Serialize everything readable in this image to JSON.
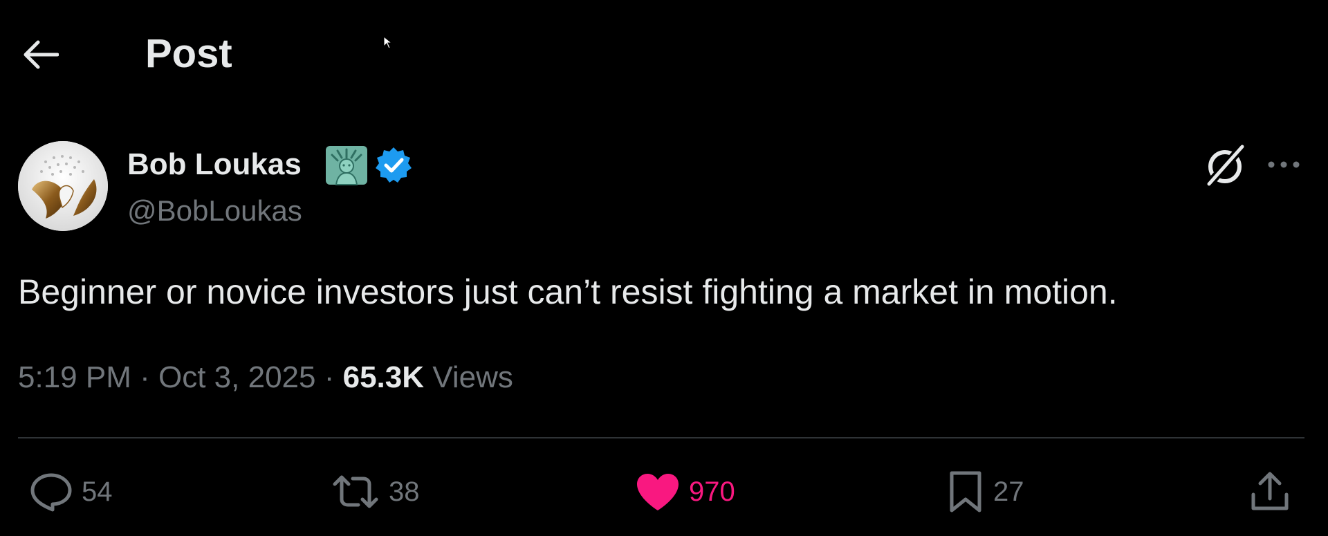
{
  "header": {
    "title": "Post",
    "back_icon": "arrow-left-icon"
  },
  "author": {
    "name": "Bob Loukas",
    "handle": "@BobLoukas",
    "badges": [
      "statue-of-liberty-icon",
      "verified-badge-icon"
    ],
    "verified_color": "#1d9bf0"
  },
  "post": {
    "text": "Beginner or novice investors just can’t resist fighting a market in motion.",
    "time": "5:19 PM",
    "separator": "·",
    "date": "Oct 3, 2025",
    "views_count": "65.3K",
    "views_label": "Views"
  },
  "actions": {
    "replies": "54",
    "reposts": "38",
    "likes": "970",
    "bookmarks": "27",
    "liked": true
  },
  "colors": {
    "background": "#000000",
    "text_primary": "#e7e9ea",
    "text_secondary": "#71767b",
    "like_active": "#f91880",
    "divider": "#2f3336"
  }
}
